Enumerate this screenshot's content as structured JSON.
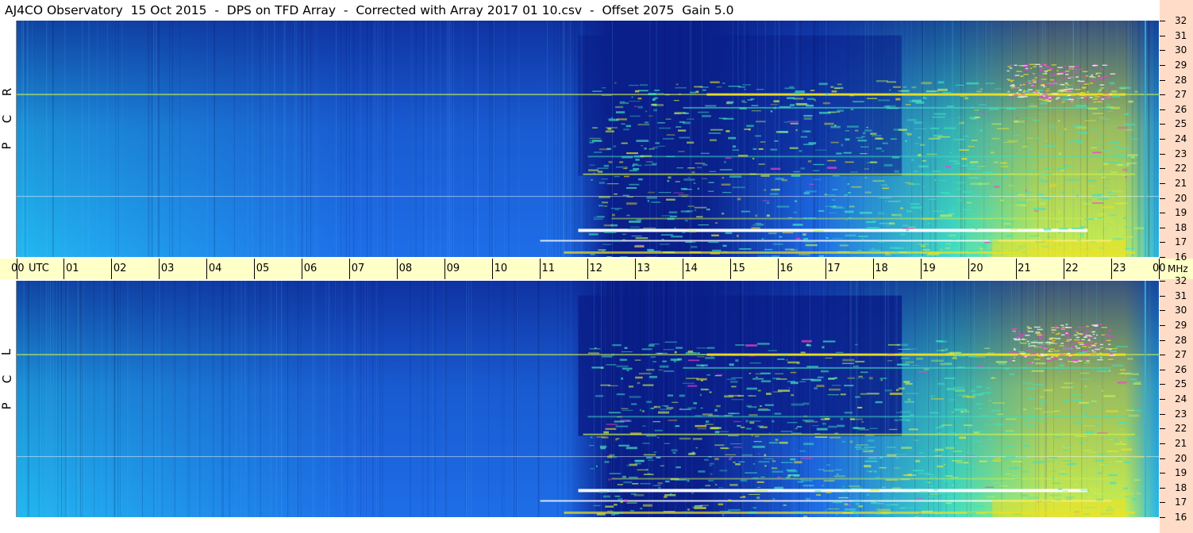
{
  "title": "AJ4CO Observatory  15 Oct 2015  -  DPS on TFD Array  -  Corrected with Array 2017 01 10.csv  -  Offset 2075  Gain 5.0",
  "chart_data": {
    "type": "heatmap",
    "panels": [
      {
        "name": "RCP",
        "label_letters": [
          "R",
          "C",
          "P"
        ]
      },
      {
        "name": "LCP",
        "label_letters": [
          "L",
          "C",
          "P"
        ]
      }
    ],
    "x_axis": {
      "unit_label": "UTC",
      "ticks": [
        "00",
        "01",
        "02",
        "03",
        "04",
        "05",
        "06",
        "07",
        "08",
        "09",
        "10",
        "11",
        "12",
        "13",
        "14",
        "15",
        "16",
        "17",
        "18",
        "19",
        "20",
        "21",
        "22",
        "23",
        "00"
      ],
      "range": [
        0,
        24
      ]
    },
    "y_axis": {
      "unit_label": "MHz",
      "ticks": [
        "16",
        "17",
        "18",
        "19",
        "20",
        "21",
        "22",
        "23",
        "24",
        "25",
        "26",
        "27",
        "28",
        "29",
        "30",
        "31",
        "32"
      ],
      "range": [
        16,
        32
      ]
    },
    "colors": {
      "background_low": "#0a1f8a",
      "background_mid": "#1e6ee8",
      "background_high": "#22b8f0",
      "medium": "#40e0c0",
      "high": "#c8f050",
      "very_high": "#f0e020",
      "peak": "#f040d0",
      "saturated": "#ffffff"
    }
  }
}
